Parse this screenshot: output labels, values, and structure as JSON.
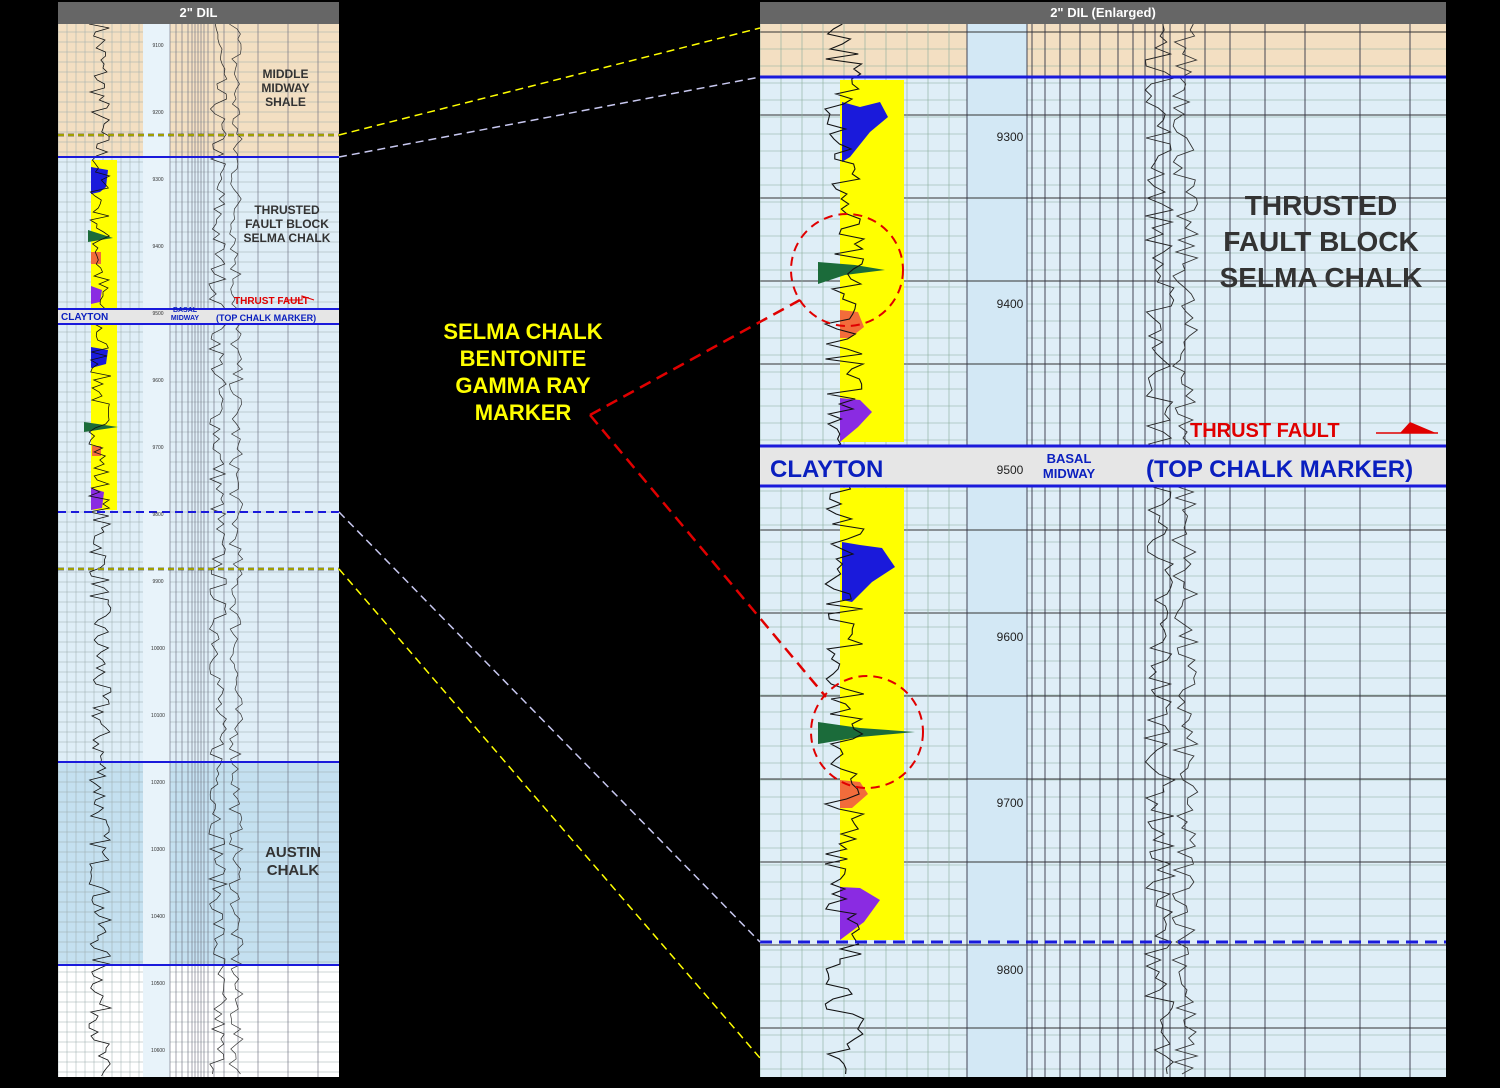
{
  "left_panel": {
    "header": "2\" DIL",
    "zones": {
      "middle_midway_shale": "MIDDLE\nMIDWAY\nSHALE",
      "thrusted_block": "THRUSTED\nFAULT BLOCK\nSELMA CHALK",
      "austin_chalk": "AUSTIN\nCHALK"
    },
    "thrust_fault": "THRUST FAULT",
    "clayton": "CLAYTON",
    "basal_midway": "BASAL\nMIDWAY",
    "top_chalk_marker": "(TOP CHALK MARKER)",
    "depth_ticks": [
      "9100",
      "9200",
      "9300",
      "9400",
      "9500",
      "9600",
      "9700",
      "9800",
      "9900",
      "10000",
      "10100",
      "10200",
      "10300",
      "10400",
      "10500",
      "10600"
    ]
  },
  "right_panel": {
    "header": "2\" DIL (Enlarged)",
    "zones": {
      "thrusted_block": "THRUSTED\nFAULT BLOCK\nSELMA CHALK"
    },
    "thrust_fault": "THRUST FAULT",
    "clayton": "CLAYTON",
    "basal_midway": "BASAL\nMIDWAY",
    "top_chalk_marker": "(TOP CHALK MARKER)",
    "depth_ticks": [
      "9300",
      "9400",
      "9500",
      "9600",
      "9700",
      "9800"
    ]
  },
  "callout": {
    "text": "SELMA CHALK\nBENTONITE\nGAMMA RAY\nMARKER"
  },
  "colors": {
    "shale_fill": "#f3dfc2",
    "chalk_fill": "#dfeef7",
    "austin_fill": "#c4e0f0",
    "gamma_yellow": "#ffff00",
    "bentonite_green": "#1b6b3a",
    "blue_marker": "#1a1adb",
    "orange_marker": "#f26c3b",
    "purple_marker": "#8a2be2",
    "formation_line": "#1a1adb",
    "thrust_red": "#e00000",
    "connector_yellow": "#ffff00",
    "connector_lavender": "#c8c8f0"
  }
}
